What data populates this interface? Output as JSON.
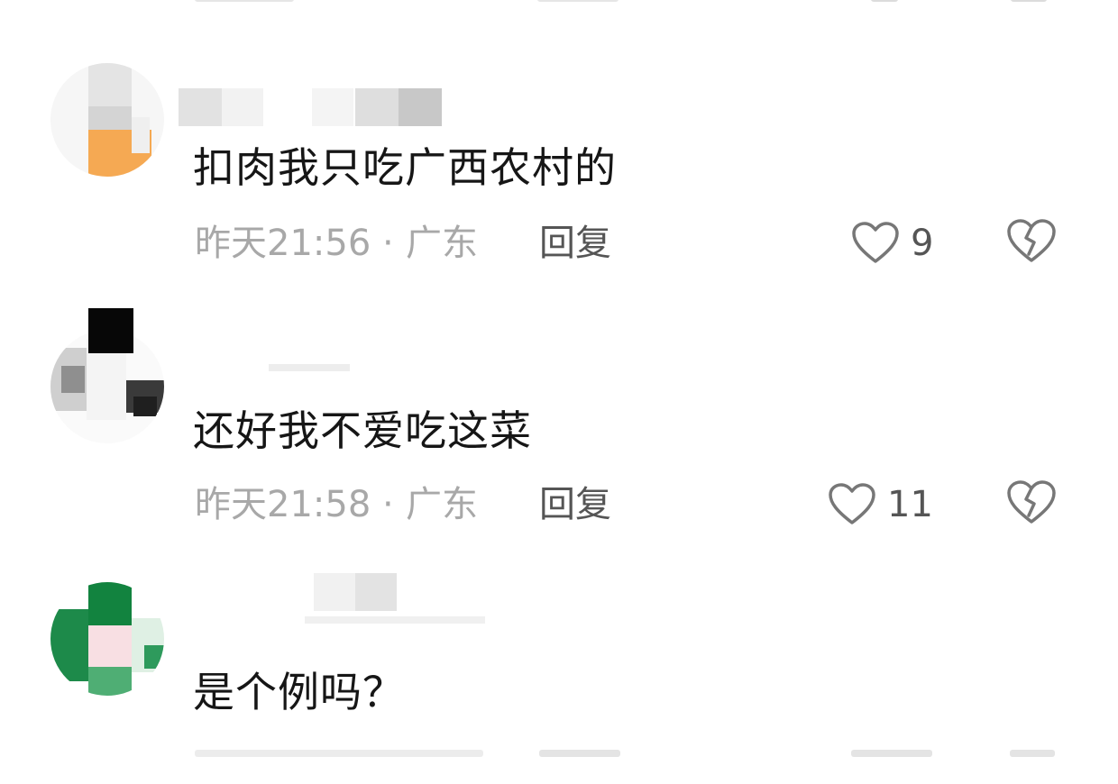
{
  "comments": [
    {
      "text": "扣肉我只吃广西农村的",
      "time": "昨天21:56",
      "separator": "·",
      "location": "广东",
      "reply_label": "回复",
      "likes": "9",
      "avatar_icon": "user-avatar-blurred",
      "username_blurred": true
    },
    {
      "text": "还好我不爱吃这菜",
      "time": "昨天21:58",
      "separator": "·",
      "location": "广东",
      "reply_label": "回复",
      "likes": "11",
      "avatar_icon": "user-avatar-blurred",
      "username_blurred": true
    },
    {
      "text": "是个例吗？",
      "time": "",
      "separator": "",
      "location": "",
      "reply_label": "",
      "likes": "",
      "avatar_icon": "user-avatar-blurred",
      "username_blurred": true
    }
  ],
  "icons": {
    "like": "heart-outline-icon",
    "dislike": "broken-heart-icon"
  },
  "colors": {
    "text_primary": "#161616",
    "text_meta": "#a8a8a8",
    "text_action": "#555555",
    "icon_stroke": "#777777"
  }
}
